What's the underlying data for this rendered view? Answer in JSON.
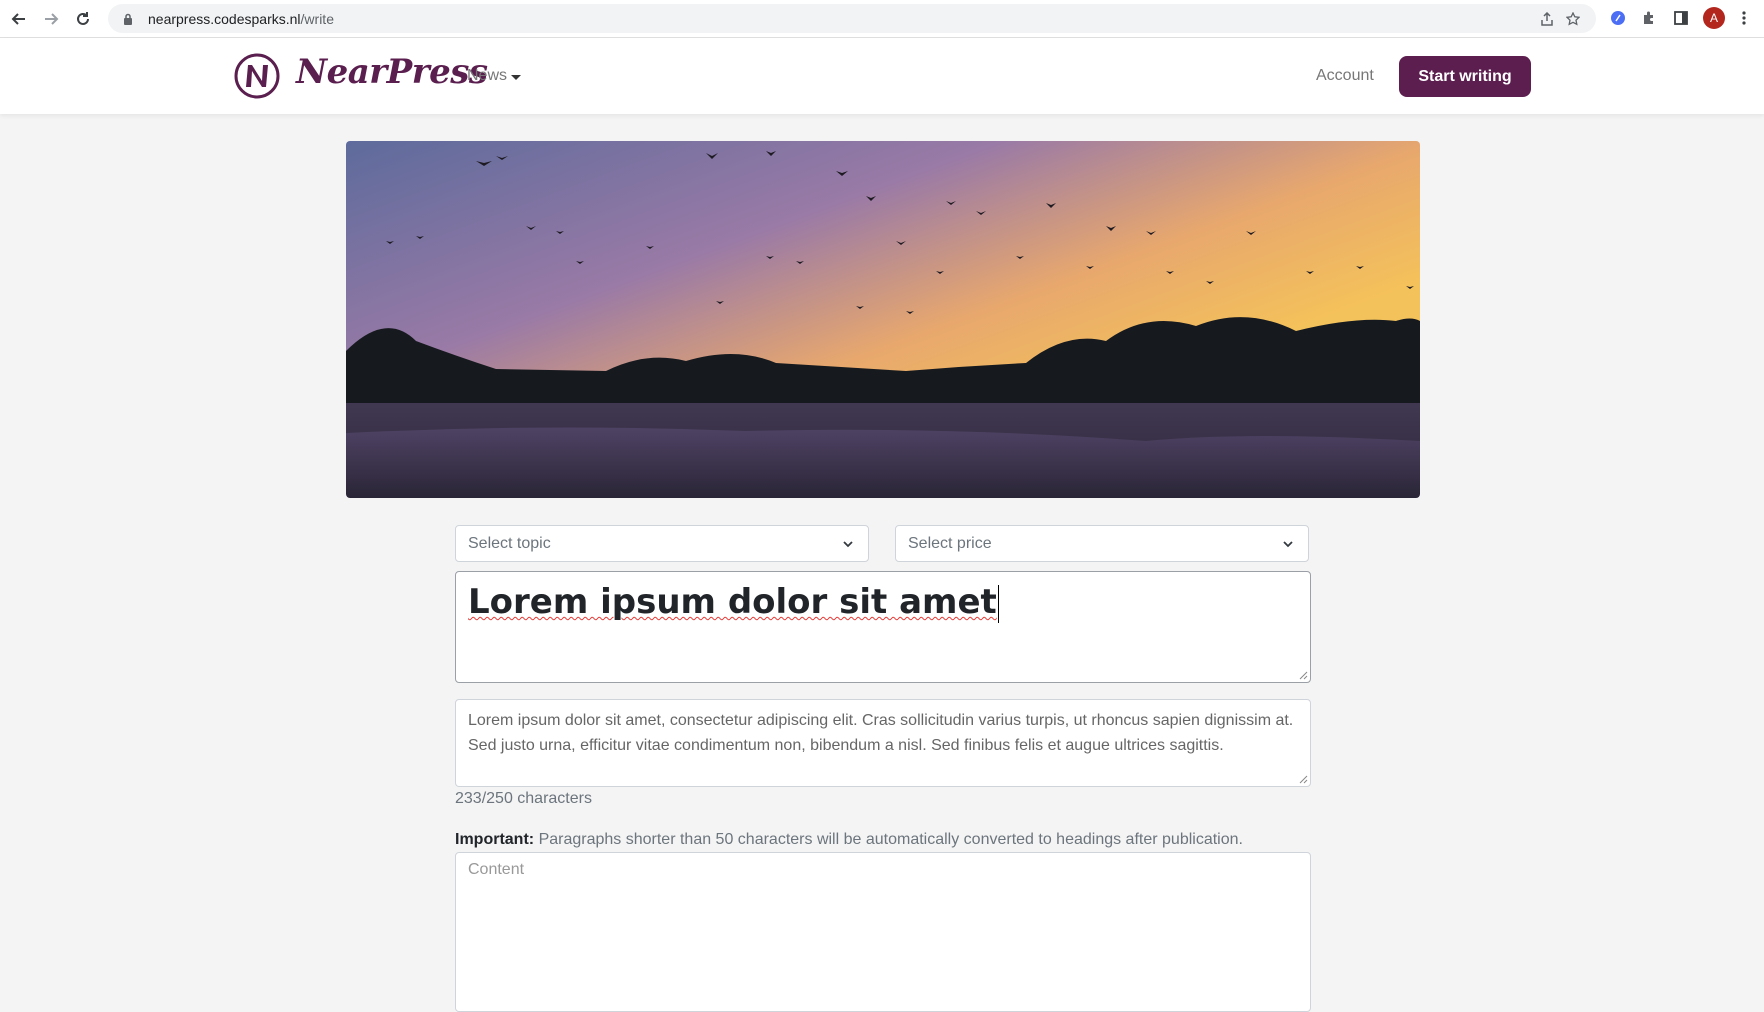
{
  "browser": {
    "url_host": "nearpress.codesparks.nl",
    "url_path": "/write",
    "profile_initial": "A"
  },
  "header": {
    "logo_text": "NearPress",
    "nav_news": "News",
    "nav_account": "Account",
    "cta": "Start writing"
  },
  "form": {
    "topic_placeholder": "Select topic",
    "price_placeholder": "Select price",
    "title_value": "Lorem ipsum dolor sit amet",
    "excerpt_value": "Lorem ipsum dolor sit amet, consectetur adipiscing elit. Cras sollicitudin varius turpis, ut rhoncus sapien dignissim at. Sed justo urna, efficitur vitae condimentum non, bibendum a nisl. Sed finibus felis et augue ultrices sagittis.",
    "char_count": "233/250 characters",
    "important_label": "Important:",
    "important_text": "Paragraphs shorter than 50 characters will be automatically converted to headings after publication.",
    "content_placeholder": "Content"
  },
  "colors": {
    "brand": "#5c1d4f",
    "background": "#f4f4f4"
  }
}
